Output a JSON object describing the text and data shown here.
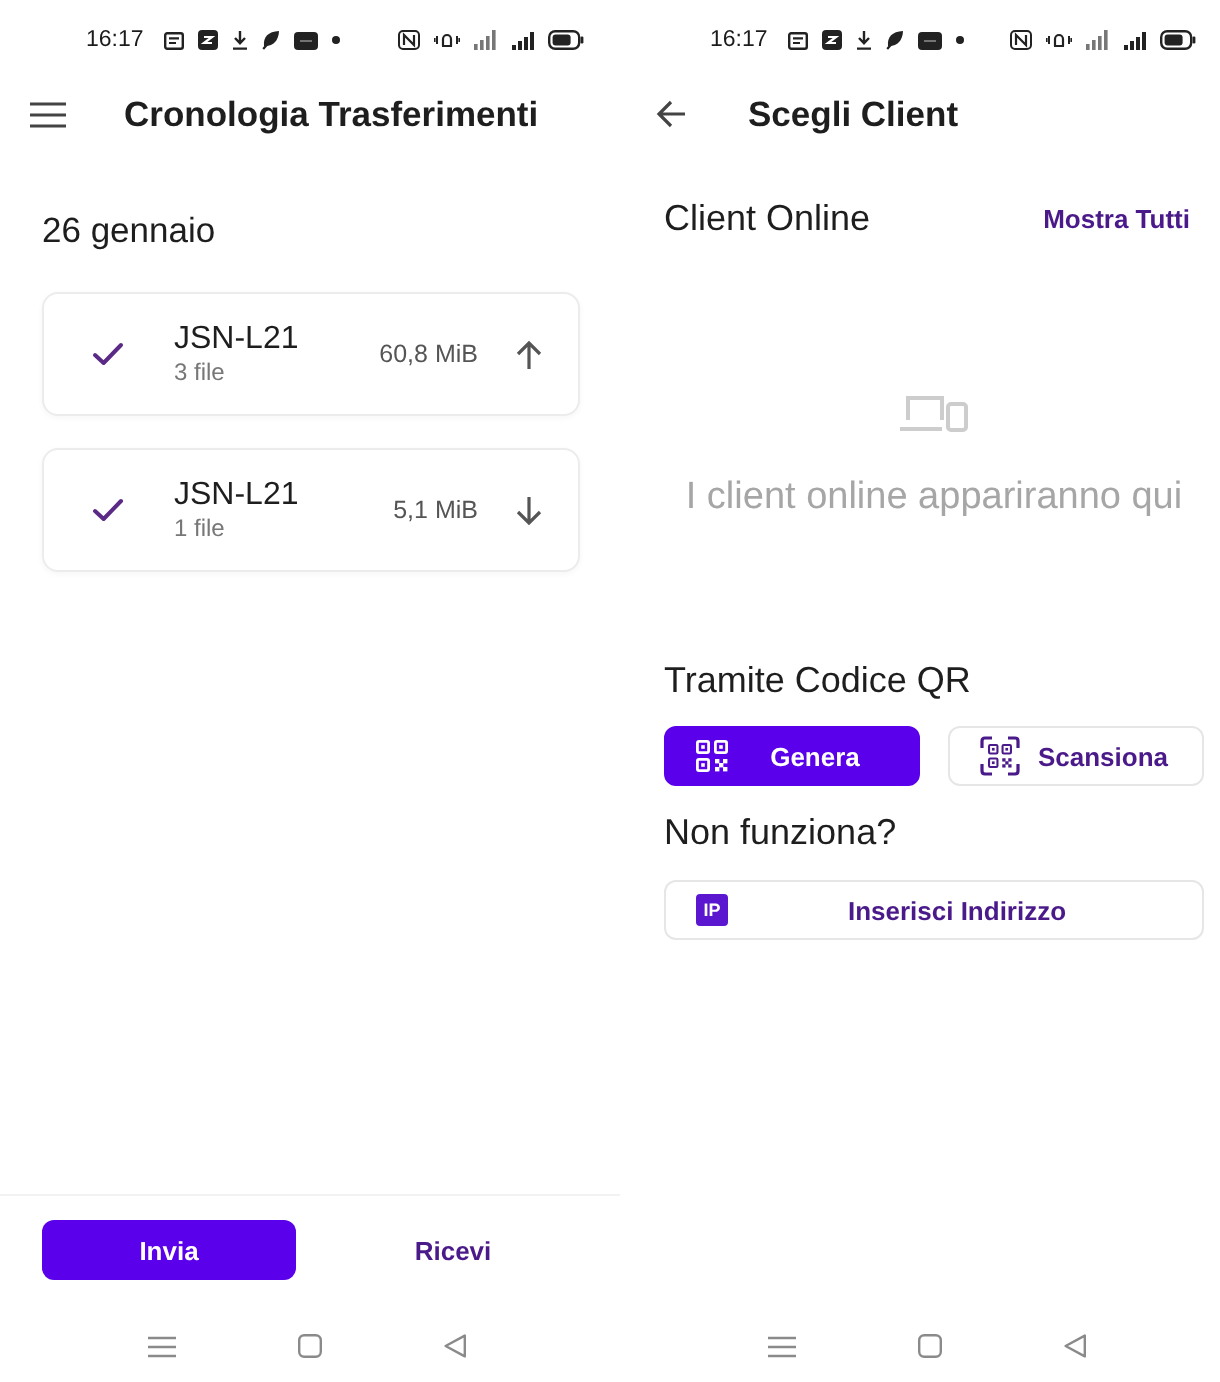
{
  "history_screen": {
    "status_bar": {
      "time": "16:17"
    },
    "title": "Cronologia Trasferimenti",
    "date_header": "26 gennaio",
    "transfers": [
      {
        "kind": "sent",
        "device": "JSN-L21",
        "files": "3 file",
        "size": "60,8 MiB",
        "completed": true
      },
      {
        "kind": "received",
        "device": "JSN-L21",
        "files": "1 file",
        "size": "5,1 MiB",
        "completed": true
      }
    ],
    "bottom_tabs": [
      {
        "label": "Invia",
        "selected": true
      },
      {
        "label": "Ricevi",
        "selected": false
      }
    ]
  },
  "client_screen": {
    "status_bar": {
      "time": "16:17"
    },
    "title": "Scegli Client",
    "online_clients": {
      "title": "Client Online",
      "show_all": "Mostra Tutti",
      "empty_message": "I client online appariranno qui"
    },
    "qr_code": {
      "title": "Tramite Codice QR",
      "buttons": [
        {
          "kind": "generate",
          "label": "Genera"
        },
        {
          "kind": "scan",
          "label": "Scansiona"
        }
      ]
    },
    "fallback": {
      "title": "Non funziona?",
      "button": {
        "badge": "IP",
        "label": "Inserisci Indirizzo"
      }
    }
  }
}
